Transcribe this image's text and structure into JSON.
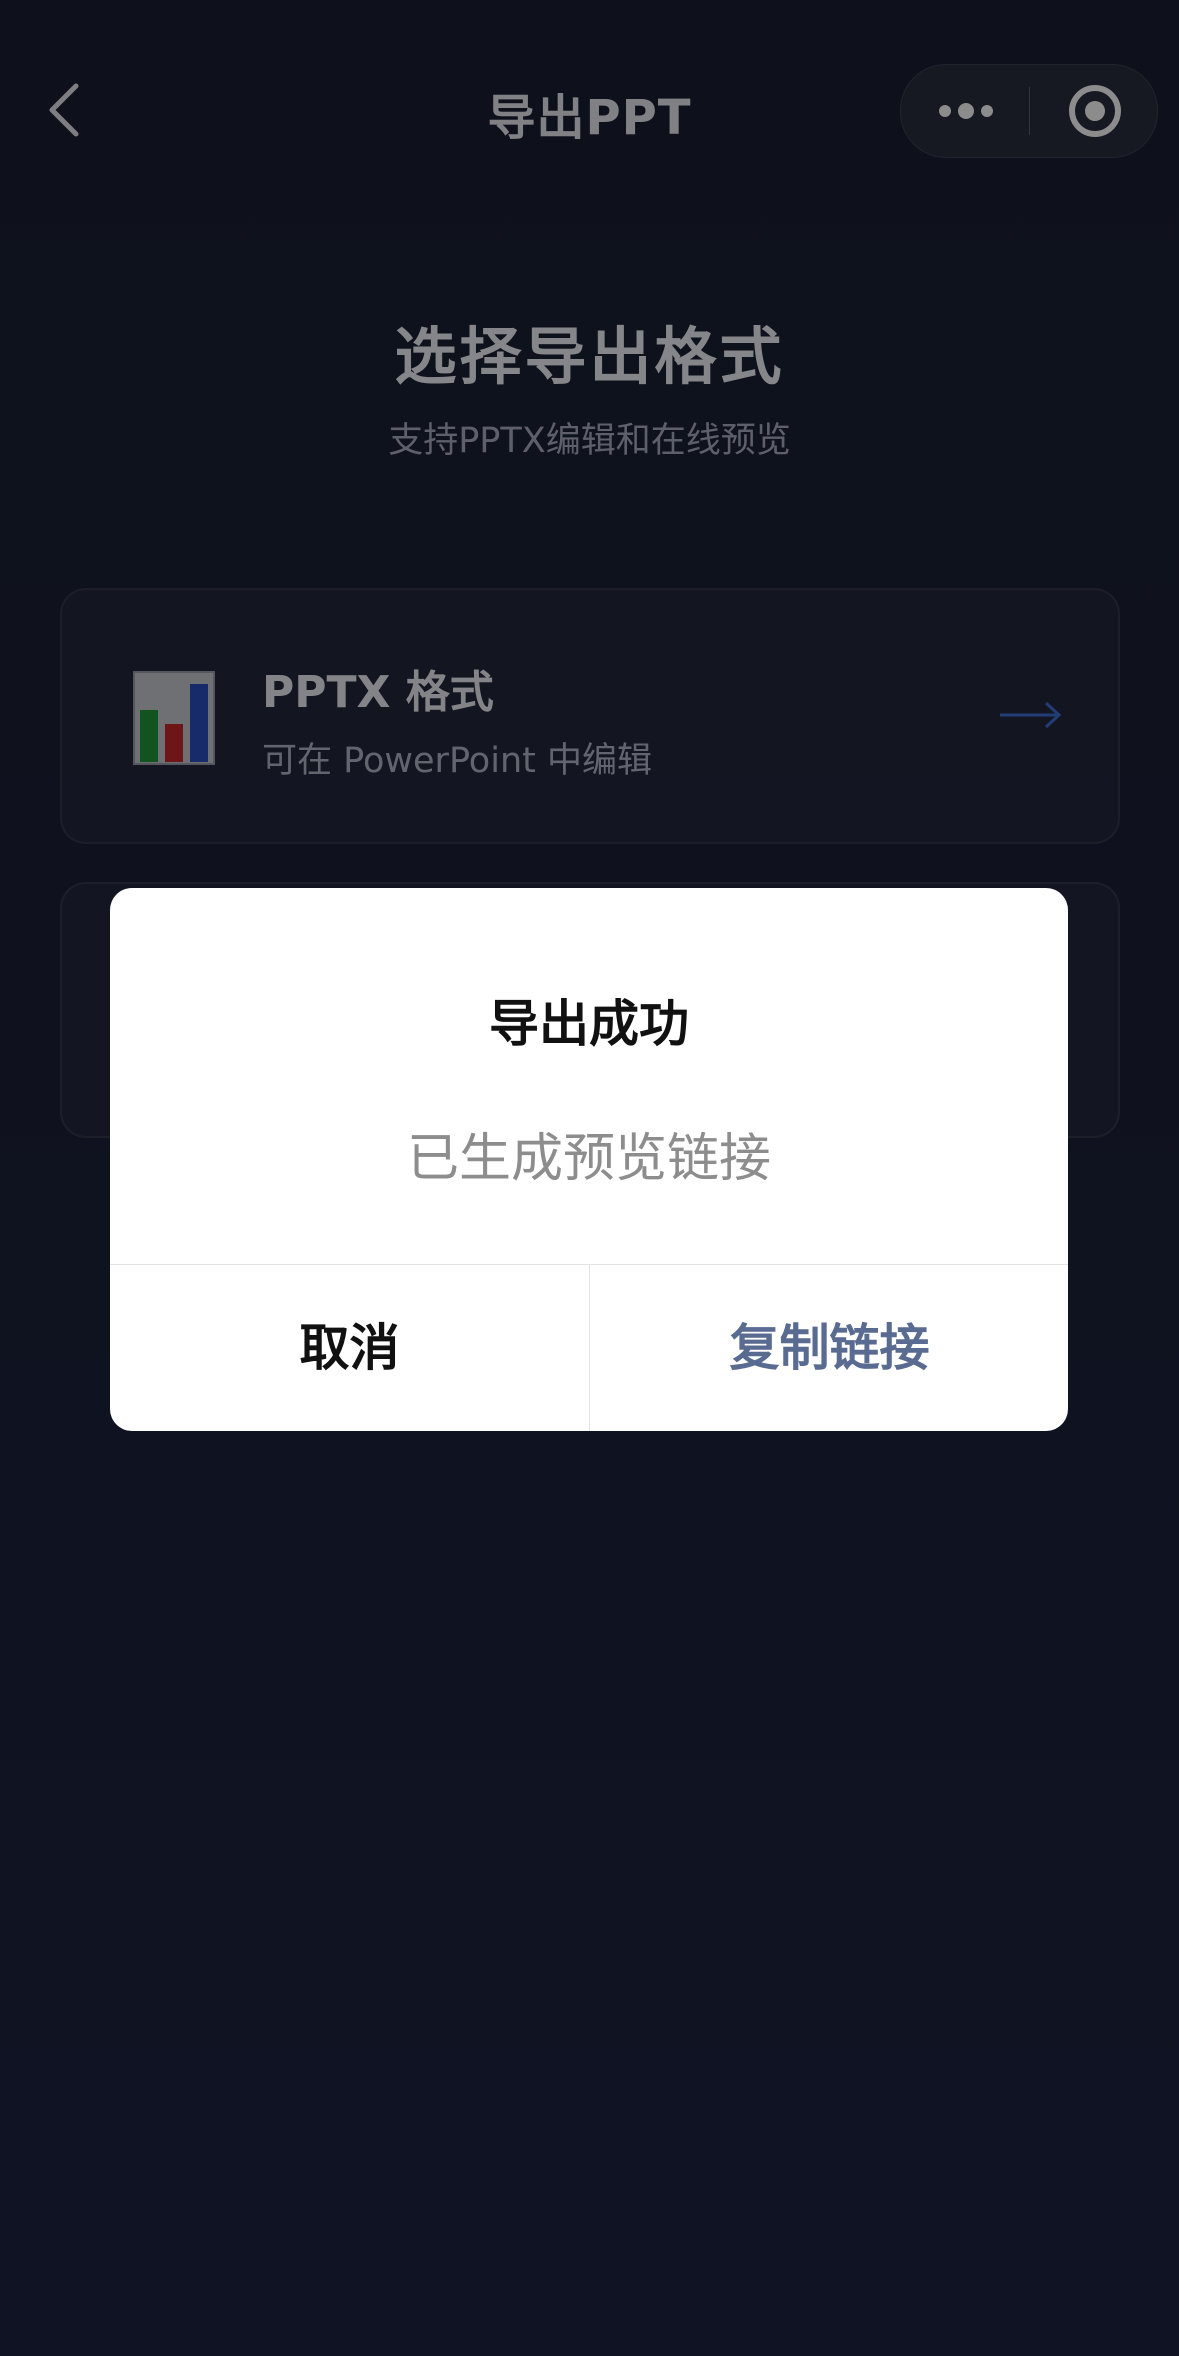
{
  "nav": {
    "title": "导出PPT"
  },
  "header": {
    "headline": "选择导出格式",
    "subhead": "支持PPTX编辑和在线预览"
  },
  "cards": [
    {
      "title": "PPTX 格式",
      "subtitle": "可在 PowerPoint 中编辑",
      "icon": "bar-chart-icon"
    }
  ],
  "dialog": {
    "title": "导出成功",
    "message": "已生成预览链接",
    "cancel_label": "取消",
    "confirm_label": "复制链接"
  },
  "colors": {
    "background": "#1c2238",
    "dialog_confirm": "#5a6b91",
    "arrow": "#3f6fd6"
  }
}
